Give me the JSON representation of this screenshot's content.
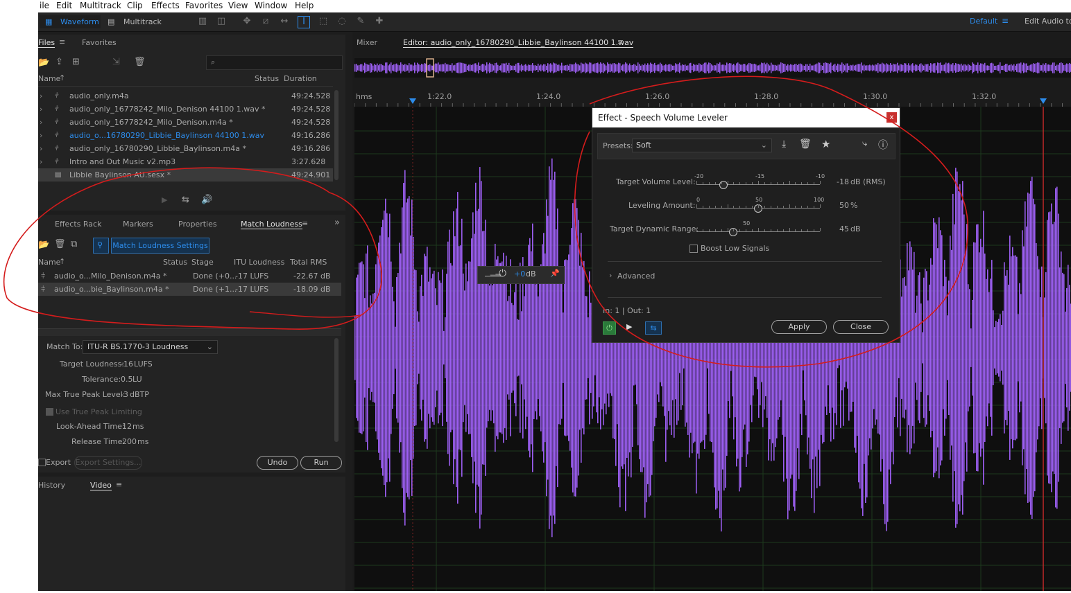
{
  "menu": [
    "ile",
    "Edit",
    "Multitrack",
    "Clip",
    "Effects",
    "Favorites",
    "View",
    "Window",
    "Help"
  ],
  "toolbar": {
    "waveform_label": "Waveform",
    "multitrack_label": "Multitrack",
    "workspace": "Default",
    "edit_audio_label": "Edit Audio to"
  },
  "files_panel": {
    "tab_files": "Files",
    "tab_favorites": "Favorites",
    "col_name": "Name",
    "col_status": "Status",
    "col_duration": "Duration",
    "rows": [
      {
        "name": "audio_only.m4a",
        "duration": "49:24.528",
        "highlight": false
      },
      {
        "name": "audio_only_16778242_Milo_Denison 44100 1.wav *",
        "duration": "49:24.528",
        "highlight": false
      },
      {
        "name": "audio_only_16778242_Milo_Denison.m4a *",
        "duration": "49:24.528",
        "highlight": false
      },
      {
        "name": "audio_o...16780290_Libbie_Baylinson 44100 1.wav",
        "duration": "49:16.286",
        "highlight": true
      },
      {
        "name": "audio_only_16780290_Libbie_Baylinson.m4a *",
        "duration": "49:16.286",
        "highlight": false
      },
      {
        "name": "Intro and Out Music v2.mp3",
        "duration": "3:27.628",
        "highlight": false
      },
      {
        "name": "Libbie Baylinson AU.sesx *",
        "duration": "49:24.901",
        "highlight": false
      }
    ]
  },
  "lower_tabs": {
    "effects_rack": "Effects Rack",
    "markers": "Markers",
    "properties": "Properties",
    "match_loudness": "Match Loudness"
  },
  "match_loudness": {
    "settings_button": "Match Loudness Settings",
    "col_name": "Name",
    "col_status": "Status",
    "col_stage": "Stage",
    "col_itu": "ITU Loudness",
    "col_rms": "Total RMS",
    "rows": [
      {
        "name": "audio_o...Milo_Denison.m4a *",
        "stage": "Done (+0...",
        "itu": "-17 LUFS",
        "rms": "-22.67 dB"
      },
      {
        "name": "audio_o...bie_Baylinson.m4a *",
        "stage": "Done (+1...",
        "itu": "-17 LUFS",
        "rms": "-18.09 dB"
      }
    ],
    "match_to_label": "Match To:",
    "match_to_value": "ITU-R BS.1770-3 Loudness",
    "target_loudness_label": "Target Loudness:",
    "target_loudness_value": "-16",
    "target_loudness_unit": "LUFS",
    "tolerance_label": "Tolerance:",
    "tolerance_value": "0.5",
    "tolerance_unit": "LU",
    "max_true_peak_label": "Max True Peak Level:",
    "max_true_peak_value": "-3",
    "max_true_peak_unit": "dBTP",
    "use_true_peak_label": "Use True Peak Limiting",
    "look_ahead_label": "Look-Ahead Time:",
    "look_ahead_value": "12",
    "look_ahead_unit": "ms",
    "release_label": "Release Time:",
    "release_value": "200",
    "release_unit": "ms",
    "export_label": "Export",
    "export_settings_label": "Export Settings...",
    "undo_label": "Undo",
    "run_label": "Run"
  },
  "bottom_tabs": {
    "history": "History",
    "video": "Video"
  },
  "editor": {
    "mixer_tab": "Mixer",
    "editor_tab": "Editor: audio_only_16780290_Libbie_Baylinson 44100 1.wav",
    "ruler_unit": "hms",
    "ruler_labels": [
      "1:22.0",
      "1:24.0",
      "1:26.0",
      "1:28.0",
      "1:30.0",
      "1:32.0"
    ],
    "hud_gain": "+0",
    "hud_unit": "dB",
    "waveform_color": "#9b5ef0"
  },
  "dialog": {
    "title": "Effect - Speech Volume Leveler",
    "close": "x",
    "presets_label": "Presets:",
    "preset_value": "Soft",
    "target_volume_label": "Target Volume Level:",
    "target_volume_ticks": [
      "-20",
      "-15",
      "-10"
    ],
    "target_volume_value": "-18",
    "target_volume_unit": "dB (RMS)",
    "target_volume_fraction": 0.22,
    "leveling_label": "Leveling Amount:",
    "leveling_ticks": [
      "0",
      "50",
      "100"
    ],
    "leveling_value": "50",
    "leveling_unit": "%",
    "leveling_fraction": 0.5,
    "dynamic_label": "Target Dynamic Range:",
    "dynamic_ticks": [
      "50"
    ],
    "dynamic_value": "45",
    "dynamic_unit": "dB",
    "dynamic_fraction": 0.3,
    "boost_label": "Boost Low Signals",
    "advanced_label": "Advanced",
    "io_label": "In: 1 | Out: 1",
    "apply_label": "Apply",
    "close_label": "Close"
  }
}
